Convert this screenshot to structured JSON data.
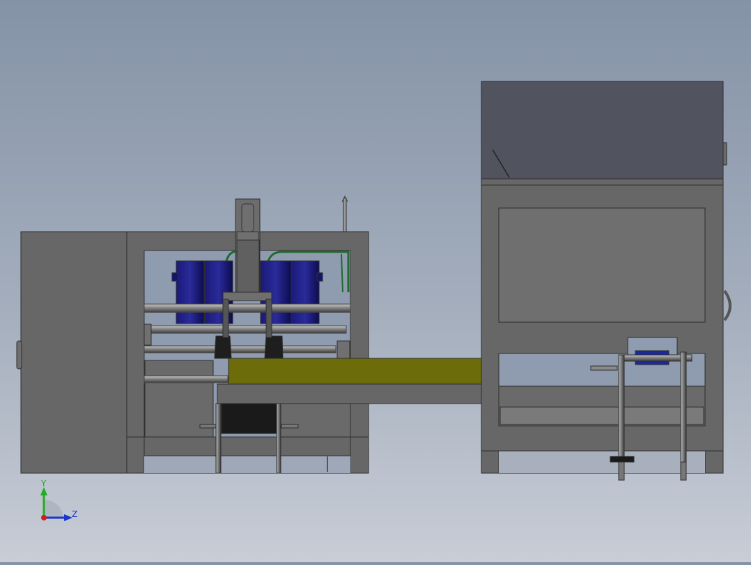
{
  "viewport": {
    "background_top": "#8593a7",
    "background_bottom": "#c8cdd6"
  },
  "triad": {
    "y_label": "Y",
    "z_label": "Z",
    "y_color": "#1fae1f",
    "z_color": "#1a35c8",
    "x_color": "#d21f1f"
  },
  "colors": {
    "frame": "#666666",
    "frame_edge": "#333333",
    "motor": "#12126e",
    "belt": "#6c6c0a",
    "hood": "#51535f",
    "pipe": "#8a8a8a",
    "hose": "#1f6a2f"
  }
}
